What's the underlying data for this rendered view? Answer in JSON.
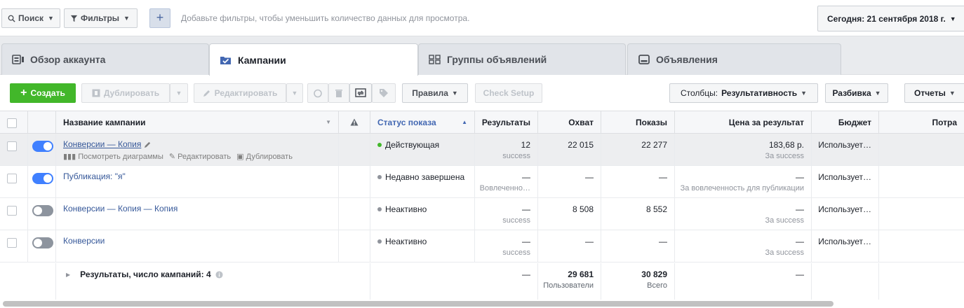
{
  "filter_bar": {
    "search_label": "Поиск",
    "filters_label": "Фильтры",
    "add_label": "+",
    "hint": "Добавьте фильтры, чтобы уменьшить количество данных для просмотра.",
    "date_label": "Сегодня: 21 сентября 2018 г."
  },
  "tabs": [
    {
      "label": "Обзор аккаунта",
      "icon": "account-overview-icon",
      "active": false
    },
    {
      "label": "Кампании",
      "icon": "campaigns-icon",
      "active": true
    },
    {
      "label": "Группы объявлений",
      "icon": "ad-sets-icon",
      "active": false
    },
    {
      "label": "Объявления",
      "icon": "ads-icon",
      "active": false
    }
  ],
  "toolbar": {
    "create_label": "Создать",
    "duplicate_label": "Дублировать",
    "edit_label": "Редактировать",
    "rules_label": "Правила",
    "check_setup_label": "Check Setup",
    "columns_label": "Столбцы:",
    "columns_value": "Результативность",
    "breakdown_label": "Разбивка",
    "reports_label": "Отчеты"
  },
  "columns": {
    "name": "Название кампании",
    "status": "Статус показа",
    "results": "Результаты",
    "reach": "Охват",
    "impressions": "Показы",
    "cost": "Цена за результат",
    "budget": "Бюджет",
    "spent": "Потра"
  },
  "rows": [
    {
      "on": true,
      "name": "Конверсии — Копия",
      "actions": [
        "Посмотреть диаграммы",
        "Редактировать",
        "Дублировать"
      ],
      "status": "Действующая",
      "status_color": "#42b72a",
      "results": "12",
      "results_sub": "success",
      "reach": "22 015",
      "impressions": "22 277",
      "cost": "183,68 р.",
      "cost_sub": "За success",
      "budget": "Использует…"
    },
    {
      "on": true,
      "name": "Публикация: \"я\"",
      "status": "Недавно завершена",
      "status_color": "#90949c",
      "results": "—",
      "results_sub": "Вовлеченно…",
      "reach": "—",
      "impressions": "—",
      "cost": "—",
      "cost_sub": "За вовлеченность для публикации",
      "budget": "Использует…"
    },
    {
      "on": false,
      "name": "Конверсии — Копия — Копия",
      "status": "Неактивно",
      "status_color": "#90949c",
      "results": "—",
      "results_sub": "success",
      "reach": "8 508",
      "impressions": "8 552",
      "cost": "—",
      "cost_sub": "За success",
      "budget": "Использует…"
    },
    {
      "on": false,
      "name": "Конверсии",
      "status": "Неактивно",
      "status_color": "#90949c",
      "results": "—",
      "results_sub": "success",
      "reach": "—",
      "impressions": "—",
      "cost": "—",
      "cost_sub": "За success",
      "budget": "Использует…"
    }
  ],
  "summary": {
    "label": "Результаты, число кампаний: 4",
    "results": "—",
    "reach": "29 681",
    "reach_sub": "Пользователи",
    "impressions": "30 829",
    "impressions_sub": "Всего",
    "cost": "—"
  },
  "colors": {
    "accent_blue": "#4080ff",
    "create_green": "#42b72a",
    "link": "#365899"
  }
}
